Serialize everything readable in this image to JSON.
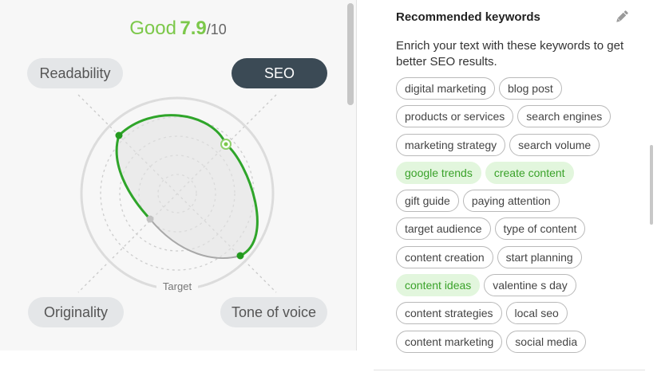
{
  "score": {
    "word": "Good",
    "value": "7.9",
    "denominator": "/10"
  },
  "radar": {
    "axes": [
      "Readability",
      "SEO",
      "Originality",
      "Tone of voice"
    ],
    "active_axis": "SEO",
    "target_label": "Target",
    "colors": {
      "accent": "#2fa52a",
      "active_pill": "#3b4a55",
      "pill": "#e4e6e8",
      "score": "#7cc84a"
    }
  },
  "keywords": {
    "title": "Recommended keywords",
    "description": "Enrich your text with these keywords to get better SEO results.",
    "rows": [
      [
        {
          "label": "digital marketing",
          "used": false
        },
        {
          "label": "blog post",
          "used": false
        }
      ],
      [
        {
          "label": "products or services",
          "used": false
        },
        {
          "label": "search engines",
          "used": false
        }
      ],
      [
        {
          "label": "marketing strategy",
          "used": false
        },
        {
          "label": "search volume",
          "used": false
        }
      ],
      [
        {
          "label": "google trends",
          "used": true
        },
        {
          "label": "create content",
          "used": true
        }
      ],
      [
        {
          "label": "gift guide",
          "used": false
        },
        {
          "label": "paying attention",
          "used": false
        }
      ],
      [
        {
          "label": "target audience",
          "used": false
        },
        {
          "label": "type of content",
          "used": false
        }
      ],
      [
        {
          "label": "content creation",
          "used": false
        },
        {
          "label": "start planning",
          "used": false
        }
      ],
      [
        {
          "label": "content ideas",
          "used": true
        },
        {
          "label": "valentine s day",
          "used": false
        }
      ],
      [
        {
          "label": "content strategies",
          "used": false
        },
        {
          "label": "local seo",
          "used": false
        }
      ],
      [
        {
          "label": "content marketing",
          "used": false
        },
        {
          "label": "social media",
          "used": false
        }
      ]
    ],
    "highlight_color": "#e2f6dd",
    "highlight_text_color": "#3aa22a"
  }
}
